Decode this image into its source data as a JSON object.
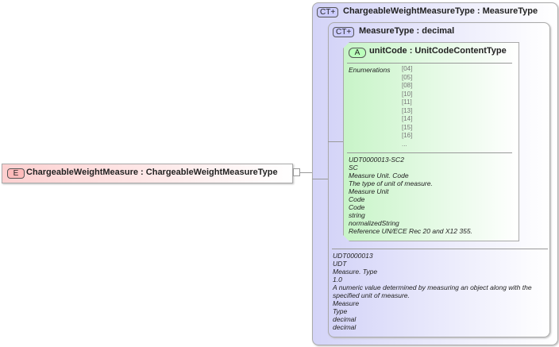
{
  "element": {
    "badge": "E",
    "title": "ChargeableWeightMeasure : ChargeableWeightMeasureType"
  },
  "outer_type": {
    "badge": "CT+",
    "title": "ChargeableWeightMeasureType : MeasureType"
  },
  "inner_type": {
    "badge": "CT+",
    "title": "MeasureType : decimal",
    "docs": [
      "UDT0000013",
      "UDT",
      "Measure. Type",
      "1.0",
      "A numeric value determined by measuring an object along with the",
      "specified unit of measure.",
      "Measure",
      "Type",
      "decimal",
      "decimal"
    ]
  },
  "attribute": {
    "badge": "A",
    "title": "unitCode : UnitCodeContentType",
    "enum_label": "Enumerations",
    "enumerations": [
      "[04]",
      "[05]",
      "[08]",
      "[10]",
      "[11]",
      "[13]",
      "[14]",
      "[15]",
      "[16]",
      "..."
    ],
    "docs": [
      "UDT0000013-SC2",
      "SC",
      "Measure Unit. Code",
      "The type of unit of measure.",
      "Measure Unit",
      "Code",
      "Code",
      "string",
      "normalizedString",
      "Reference UN/ECE Rec 20 and X12 355."
    ]
  },
  "colors": {
    "element_bg": "#fdd8d8",
    "type_bg": "#dcdcfa",
    "attribute_bg": "#d8f8d8"
  }
}
